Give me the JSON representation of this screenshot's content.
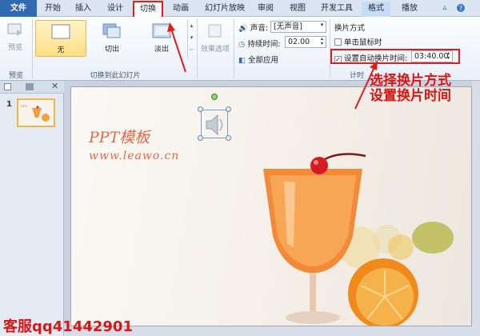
{
  "tabs": {
    "file": "文件",
    "home": "开始",
    "insert": "插入",
    "design": "设计",
    "transitions": "切换",
    "animations": "动画",
    "slideshow": "幻灯片放映",
    "review": "审阅",
    "view": "视图",
    "developer": "开发工具",
    "format": "格式",
    "playback": "播放"
  },
  "ribbon": {
    "preview": "预览",
    "preview_group": "预览",
    "effects": [
      "无",
      "切出",
      "淡出"
    ],
    "transition_group": "切换到此幻灯片",
    "effect_options": "效果选项",
    "sound_label": "声音:",
    "sound_value": "[无声音]",
    "duration_label": "持续时间:",
    "duration_value": "02.00",
    "apply_all": "全部应用",
    "advance_title": "换片方式",
    "on_click": "单击鼠标时",
    "auto_label": "设置自动换片时间:",
    "auto_value": "03:40.00",
    "timing_group": "计时"
  },
  "thumbs": {
    "slide_number": "1"
  },
  "slide": {
    "title": "PPT模板",
    "url": "www.leawo.cn"
  },
  "annotation": {
    "line1": "选择换片方式",
    "line2": "设置换片时间",
    "contact": "客服qq41442901"
  },
  "colors": {
    "annotation_red": "#e01e1e",
    "file_tab": "#2f6ab3"
  }
}
